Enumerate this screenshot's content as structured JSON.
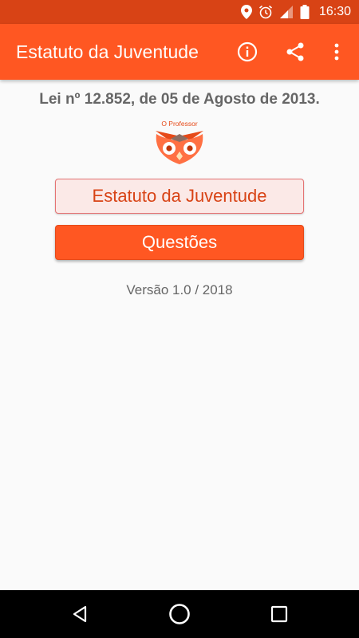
{
  "status_bar": {
    "time": "16:30",
    "icons": [
      "location-icon",
      "alarm-icon",
      "signal-icon",
      "battery-icon"
    ]
  },
  "app_bar": {
    "title": "Estatuto da Juventude",
    "actions": [
      "info-icon",
      "share-icon",
      "more-vert-icon"
    ]
  },
  "main": {
    "law_title": "Lei nº 12.852, de 05 de Agosto de 2013.",
    "logo_text": "O Professor",
    "buttons": {
      "estatuto": "Estatuto da Juventude",
      "questoes": "Questões"
    },
    "version": "Versão 1.0 / 2018"
  },
  "nav_bar": {
    "buttons": [
      "back-icon",
      "home-icon",
      "recents-icon"
    ]
  },
  "colors": {
    "primary": "#ff5722",
    "primary_dark": "#d84315",
    "button_light_bg": "#fbe9e7",
    "text_gray": "#666666"
  }
}
